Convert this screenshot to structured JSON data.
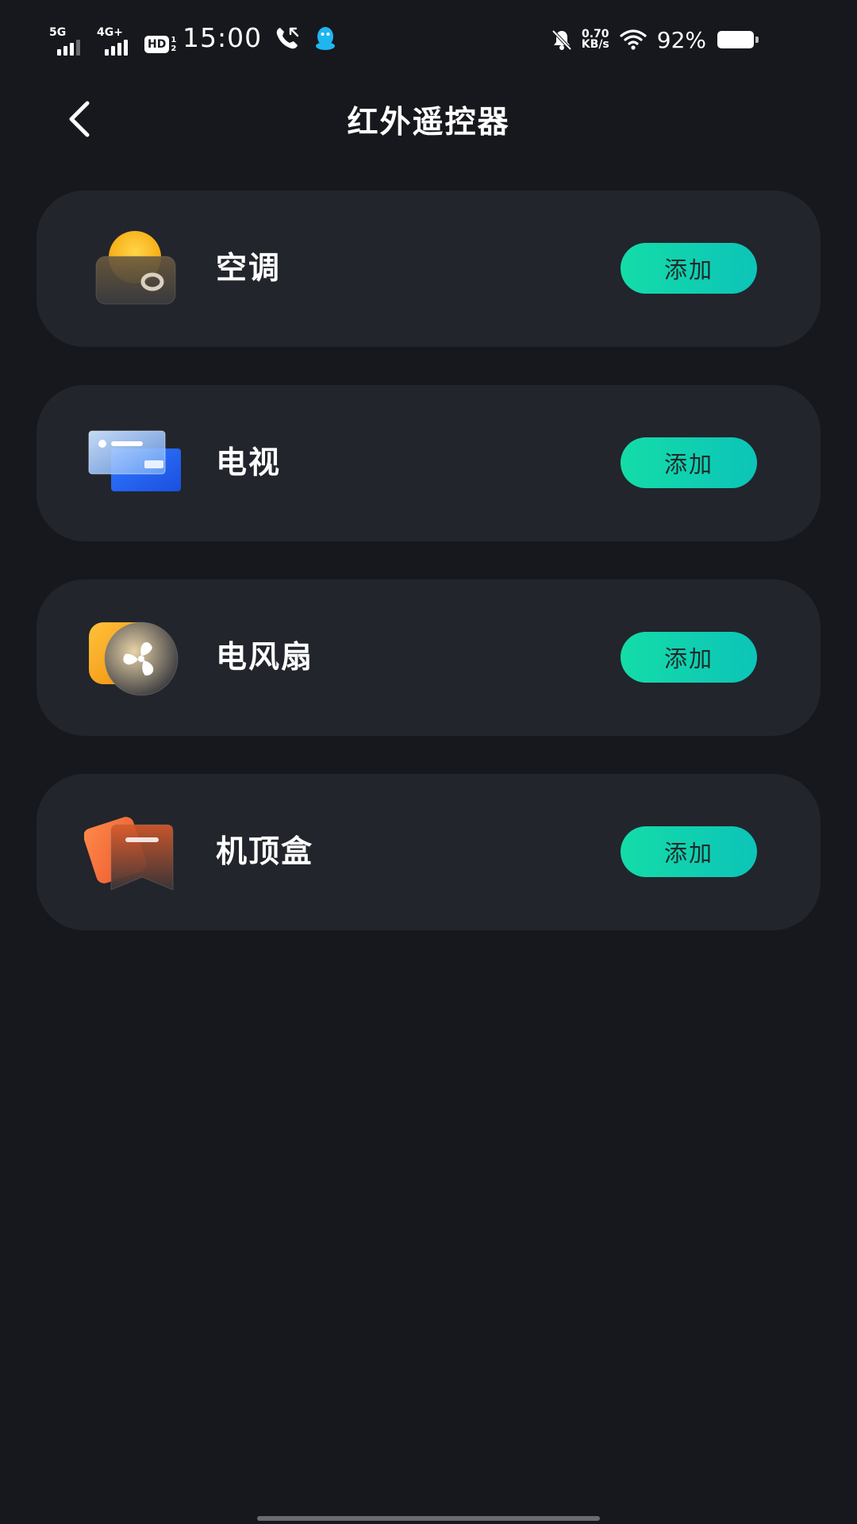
{
  "status_bar": {
    "net1": "5G",
    "net2": "4G+",
    "hd_label": "HD",
    "hd_fraction_top": "1",
    "hd_fraction_bottom": "2",
    "time": "15:00",
    "speed_value": "0.70",
    "speed_unit": "KB/s",
    "battery": "92%",
    "icons": [
      "call-icon",
      "qq-icon",
      "mute-bell-icon",
      "wifi-icon",
      "battery-icon"
    ]
  },
  "header": {
    "title": "红外遥控器",
    "back_icon": "chevron-left-icon"
  },
  "devices": [
    {
      "name": "空调",
      "add_label": "添加",
      "icon": "air-conditioner-icon"
    },
    {
      "name": "电视",
      "add_label": "添加",
      "icon": "tv-icon"
    },
    {
      "name": "电风扇",
      "add_label": "添加",
      "icon": "fan-icon"
    },
    {
      "name": "机顶盒",
      "add_label": "添加",
      "icon": "set-top-box-icon"
    }
  ],
  "colors": {
    "background": "#17181d",
    "card": "#22252b",
    "accent_start": "#14dca8",
    "accent_end": "#0cc4b8"
  }
}
